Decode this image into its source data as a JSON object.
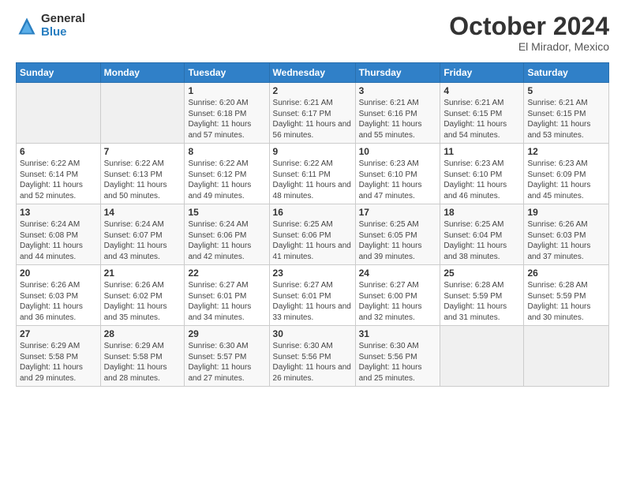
{
  "logo": {
    "general": "General",
    "blue": "Blue"
  },
  "header": {
    "month": "October 2024",
    "location": "El Mirador, Mexico"
  },
  "weekdays": [
    "Sunday",
    "Monday",
    "Tuesday",
    "Wednesday",
    "Thursday",
    "Friday",
    "Saturday"
  ],
  "weeks": [
    [
      {
        "day": "",
        "info": ""
      },
      {
        "day": "",
        "info": ""
      },
      {
        "day": "1",
        "info": "Sunrise: 6:20 AM\nSunset: 6:18 PM\nDaylight: 11 hours and 57 minutes."
      },
      {
        "day": "2",
        "info": "Sunrise: 6:21 AM\nSunset: 6:17 PM\nDaylight: 11 hours and 56 minutes."
      },
      {
        "day": "3",
        "info": "Sunrise: 6:21 AM\nSunset: 6:16 PM\nDaylight: 11 hours and 55 minutes."
      },
      {
        "day": "4",
        "info": "Sunrise: 6:21 AM\nSunset: 6:15 PM\nDaylight: 11 hours and 54 minutes."
      },
      {
        "day": "5",
        "info": "Sunrise: 6:21 AM\nSunset: 6:15 PM\nDaylight: 11 hours and 53 minutes."
      }
    ],
    [
      {
        "day": "6",
        "info": "Sunrise: 6:22 AM\nSunset: 6:14 PM\nDaylight: 11 hours and 52 minutes."
      },
      {
        "day": "7",
        "info": "Sunrise: 6:22 AM\nSunset: 6:13 PM\nDaylight: 11 hours and 50 minutes."
      },
      {
        "day": "8",
        "info": "Sunrise: 6:22 AM\nSunset: 6:12 PM\nDaylight: 11 hours and 49 minutes."
      },
      {
        "day": "9",
        "info": "Sunrise: 6:22 AM\nSunset: 6:11 PM\nDaylight: 11 hours and 48 minutes."
      },
      {
        "day": "10",
        "info": "Sunrise: 6:23 AM\nSunset: 6:10 PM\nDaylight: 11 hours and 47 minutes."
      },
      {
        "day": "11",
        "info": "Sunrise: 6:23 AM\nSunset: 6:10 PM\nDaylight: 11 hours and 46 minutes."
      },
      {
        "day": "12",
        "info": "Sunrise: 6:23 AM\nSunset: 6:09 PM\nDaylight: 11 hours and 45 minutes."
      }
    ],
    [
      {
        "day": "13",
        "info": "Sunrise: 6:24 AM\nSunset: 6:08 PM\nDaylight: 11 hours and 44 minutes."
      },
      {
        "day": "14",
        "info": "Sunrise: 6:24 AM\nSunset: 6:07 PM\nDaylight: 11 hours and 43 minutes."
      },
      {
        "day": "15",
        "info": "Sunrise: 6:24 AM\nSunset: 6:06 PM\nDaylight: 11 hours and 42 minutes."
      },
      {
        "day": "16",
        "info": "Sunrise: 6:25 AM\nSunset: 6:06 PM\nDaylight: 11 hours and 41 minutes."
      },
      {
        "day": "17",
        "info": "Sunrise: 6:25 AM\nSunset: 6:05 PM\nDaylight: 11 hours and 39 minutes."
      },
      {
        "day": "18",
        "info": "Sunrise: 6:25 AM\nSunset: 6:04 PM\nDaylight: 11 hours and 38 minutes."
      },
      {
        "day": "19",
        "info": "Sunrise: 6:26 AM\nSunset: 6:03 PM\nDaylight: 11 hours and 37 minutes."
      }
    ],
    [
      {
        "day": "20",
        "info": "Sunrise: 6:26 AM\nSunset: 6:03 PM\nDaylight: 11 hours and 36 minutes."
      },
      {
        "day": "21",
        "info": "Sunrise: 6:26 AM\nSunset: 6:02 PM\nDaylight: 11 hours and 35 minutes."
      },
      {
        "day": "22",
        "info": "Sunrise: 6:27 AM\nSunset: 6:01 PM\nDaylight: 11 hours and 34 minutes."
      },
      {
        "day": "23",
        "info": "Sunrise: 6:27 AM\nSunset: 6:01 PM\nDaylight: 11 hours and 33 minutes."
      },
      {
        "day": "24",
        "info": "Sunrise: 6:27 AM\nSunset: 6:00 PM\nDaylight: 11 hours and 32 minutes."
      },
      {
        "day": "25",
        "info": "Sunrise: 6:28 AM\nSunset: 5:59 PM\nDaylight: 11 hours and 31 minutes."
      },
      {
        "day": "26",
        "info": "Sunrise: 6:28 AM\nSunset: 5:59 PM\nDaylight: 11 hours and 30 minutes."
      }
    ],
    [
      {
        "day": "27",
        "info": "Sunrise: 6:29 AM\nSunset: 5:58 PM\nDaylight: 11 hours and 29 minutes."
      },
      {
        "day": "28",
        "info": "Sunrise: 6:29 AM\nSunset: 5:58 PM\nDaylight: 11 hours and 28 minutes."
      },
      {
        "day": "29",
        "info": "Sunrise: 6:30 AM\nSunset: 5:57 PM\nDaylight: 11 hours and 27 minutes."
      },
      {
        "day": "30",
        "info": "Sunrise: 6:30 AM\nSunset: 5:56 PM\nDaylight: 11 hours and 26 minutes."
      },
      {
        "day": "31",
        "info": "Sunrise: 6:30 AM\nSunset: 5:56 PM\nDaylight: 11 hours and 25 minutes."
      },
      {
        "day": "",
        "info": ""
      },
      {
        "day": "",
        "info": ""
      }
    ]
  ]
}
